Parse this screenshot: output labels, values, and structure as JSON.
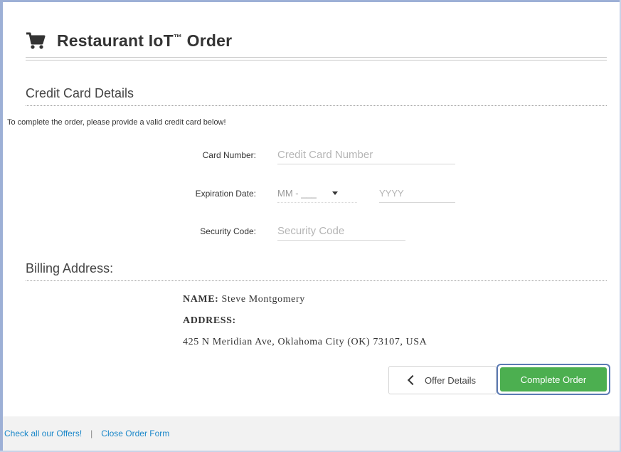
{
  "header": {
    "title": "Restaurant IoT",
    "trademark": "™",
    "icon": "cart-icon"
  },
  "credit_card": {
    "section_title": "Credit Card Details",
    "intro": "To complete the order, please provide a valid credit card below!",
    "card_number": {
      "label": "Card Number:",
      "placeholder": "Credit Card Number"
    },
    "expiration": {
      "label": "Expiration Date:",
      "month_value": "MM - ___",
      "year_placeholder": "YYYY"
    },
    "security_code": {
      "label": "Security Code:",
      "placeholder": "Security Code"
    }
  },
  "billing": {
    "section_title": "Billing Address:",
    "name_label": "NAME:",
    "name_value": "Steve Montgomery",
    "address_label": "ADDRESS:",
    "address_value": "425 N Meridian Ave, Oklahoma City (OK) 73107, USA"
  },
  "actions": {
    "offer_details": "Offer Details",
    "complete_order": "Complete Order"
  },
  "footer": {
    "offers_link": "Check all our Offers!",
    "separator": "|",
    "close_link": "Close Order Form"
  },
  "colors": {
    "accent": "#4caf50",
    "link": "#1a87c9",
    "focus_ring": "#5b7ab3"
  }
}
